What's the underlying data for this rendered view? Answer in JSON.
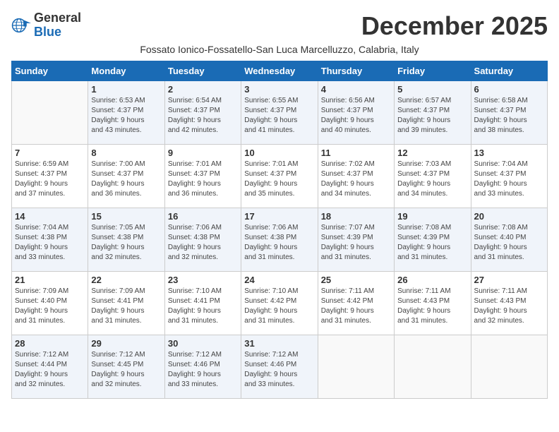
{
  "header": {
    "logo_general": "General",
    "logo_blue": "Blue",
    "month_title": "December 2025",
    "subtitle": "Fossato Ionico-Fossatello-San Luca Marcelluzzo, Calabria, Italy"
  },
  "weekdays": [
    "Sunday",
    "Monday",
    "Tuesday",
    "Wednesday",
    "Thursday",
    "Friday",
    "Saturday"
  ],
  "weeks": [
    [
      {
        "day": "",
        "info": ""
      },
      {
        "day": "1",
        "info": "Sunrise: 6:53 AM\nSunset: 4:37 PM\nDaylight: 9 hours\nand 43 minutes."
      },
      {
        "day": "2",
        "info": "Sunrise: 6:54 AM\nSunset: 4:37 PM\nDaylight: 9 hours\nand 42 minutes."
      },
      {
        "day": "3",
        "info": "Sunrise: 6:55 AM\nSunset: 4:37 PM\nDaylight: 9 hours\nand 41 minutes."
      },
      {
        "day": "4",
        "info": "Sunrise: 6:56 AM\nSunset: 4:37 PM\nDaylight: 9 hours\nand 40 minutes."
      },
      {
        "day": "5",
        "info": "Sunrise: 6:57 AM\nSunset: 4:37 PM\nDaylight: 9 hours\nand 39 minutes."
      },
      {
        "day": "6",
        "info": "Sunrise: 6:58 AM\nSunset: 4:37 PM\nDaylight: 9 hours\nand 38 minutes."
      }
    ],
    [
      {
        "day": "7",
        "info": "Sunrise: 6:59 AM\nSunset: 4:37 PM\nDaylight: 9 hours\nand 37 minutes."
      },
      {
        "day": "8",
        "info": "Sunrise: 7:00 AM\nSunset: 4:37 PM\nDaylight: 9 hours\nand 36 minutes."
      },
      {
        "day": "9",
        "info": "Sunrise: 7:01 AM\nSunset: 4:37 PM\nDaylight: 9 hours\nand 36 minutes."
      },
      {
        "day": "10",
        "info": "Sunrise: 7:01 AM\nSunset: 4:37 PM\nDaylight: 9 hours\nand 35 minutes."
      },
      {
        "day": "11",
        "info": "Sunrise: 7:02 AM\nSunset: 4:37 PM\nDaylight: 9 hours\nand 34 minutes."
      },
      {
        "day": "12",
        "info": "Sunrise: 7:03 AM\nSunset: 4:37 PM\nDaylight: 9 hours\nand 34 minutes."
      },
      {
        "day": "13",
        "info": "Sunrise: 7:04 AM\nSunset: 4:37 PM\nDaylight: 9 hours\nand 33 minutes."
      }
    ],
    [
      {
        "day": "14",
        "info": "Sunrise: 7:04 AM\nSunset: 4:38 PM\nDaylight: 9 hours\nand 33 minutes."
      },
      {
        "day": "15",
        "info": "Sunrise: 7:05 AM\nSunset: 4:38 PM\nDaylight: 9 hours\nand 32 minutes."
      },
      {
        "day": "16",
        "info": "Sunrise: 7:06 AM\nSunset: 4:38 PM\nDaylight: 9 hours\nand 32 minutes."
      },
      {
        "day": "17",
        "info": "Sunrise: 7:06 AM\nSunset: 4:38 PM\nDaylight: 9 hours\nand 31 minutes."
      },
      {
        "day": "18",
        "info": "Sunrise: 7:07 AM\nSunset: 4:39 PM\nDaylight: 9 hours\nand 31 minutes."
      },
      {
        "day": "19",
        "info": "Sunrise: 7:08 AM\nSunset: 4:39 PM\nDaylight: 9 hours\nand 31 minutes."
      },
      {
        "day": "20",
        "info": "Sunrise: 7:08 AM\nSunset: 4:40 PM\nDaylight: 9 hours\nand 31 minutes."
      }
    ],
    [
      {
        "day": "21",
        "info": "Sunrise: 7:09 AM\nSunset: 4:40 PM\nDaylight: 9 hours\nand 31 minutes."
      },
      {
        "day": "22",
        "info": "Sunrise: 7:09 AM\nSunset: 4:41 PM\nDaylight: 9 hours\nand 31 minutes."
      },
      {
        "day": "23",
        "info": "Sunrise: 7:10 AM\nSunset: 4:41 PM\nDaylight: 9 hours\nand 31 minutes."
      },
      {
        "day": "24",
        "info": "Sunrise: 7:10 AM\nSunset: 4:42 PM\nDaylight: 9 hours\nand 31 minutes."
      },
      {
        "day": "25",
        "info": "Sunrise: 7:11 AM\nSunset: 4:42 PM\nDaylight: 9 hours\nand 31 minutes."
      },
      {
        "day": "26",
        "info": "Sunrise: 7:11 AM\nSunset: 4:43 PM\nDaylight: 9 hours\nand 31 minutes."
      },
      {
        "day": "27",
        "info": "Sunrise: 7:11 AM\nSunset: 4:43 PM\nDaylight: 9 hours\nand 32 minutes."
      }
    ],
    [
      {
        "day": "28",
        "info": "Sunrise: 7:12 AM\nSunset: 4:44 PM\nDaylight: 9 hours\nand 32 minutes."
      },
      {
        "day": "29",
        "info": "Sunrise: 7:12 AM\nSunset: 4:45 PM\nDaylight: 9 hours\nand 32 minutes."
      },
      {
        "day": "30",
        "info": "Sunrise: 7:12 AM\nSunset: 4:46 PM\nDaylight: 9 hours\nand 33 minutes."
      },
      {
        "day": "31",
        "info": "Sunrise: 7:12 AM\nSunset: 4:46 PM\nDaylight: 9 hours\nand 33 minutes."
      },
      {
        "day": "",
        "info": ""
      },
      {
        "day": "",
        "info": ""
      },
      {
        "day": "",
        "info": ""
      }
    ]
  ]
}
